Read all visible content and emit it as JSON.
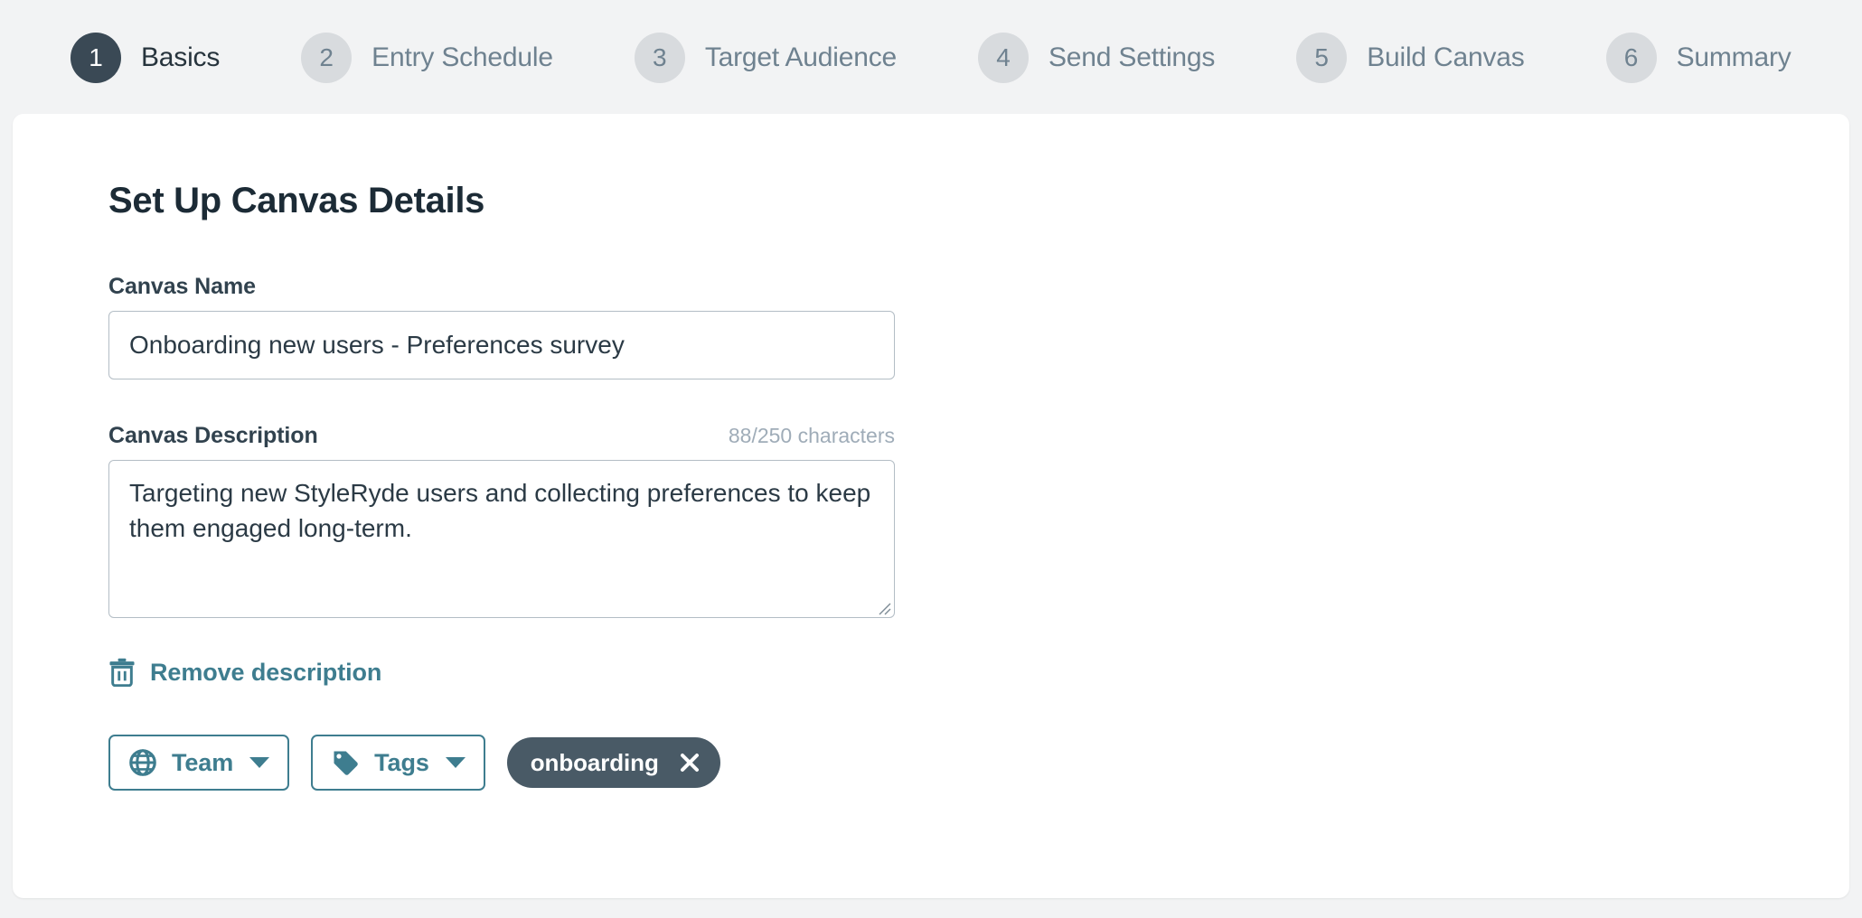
{
  "stepper": {
    "steps": [
      {
        "number": "1",
        "label": "Basics",
        "active": true
      },
      {
        "number": "2",
        "label": "Entry Schedule",
        "active": false
      },
      {
        "number": "3",
        "label": "Target Audience",
        "active": false
      },
      {
        "number": "4",
        "label": "Send Settings",
        "active": false
      },
      {
        "number": "5",
        "label": "Build Canvas",
        "active": false
      },
      {
        "number": "6",
        "label": "Summary",
        "active": false
      }
    ]
  },
  "main": {
    "title": "Set Up Canvas Details",
    "canvas_name": {
      "label": "Canvas Name",
      "value": "Onboarding new users - Preferences survey",
      "placeholder": "Canvas Name"
    },
    "canvas_description": {
      "label": "Canvas Description",
      "counter": "88/250 characters",
      "value": "Targeting new StyleRyde users and collecting preferences to keep them engaged long-term.",
      "placeholder": "Canvas Description"
    },
    "remove_description": {
      "label": "Remove description",
      "icon": "trash-icon"
    },
    "team_button": {
      "label": "Team",
      "icon": "globe-icon"
    },
    "tags_button": {
      "label": "Tags",
      "icon": "tag-icon"
    },
    "tags": [
      {
        "label": "onboarding"
      }
    ]
  },
  "colors": {
    "page_background": "#f2f3f4",
    "card_background": "#ffffff",
    "accent_teal": "#3e7d8f",
    "dark_slate": "#3a4955",
    "chip_background": "#495a66",
    "step_inactive": "#d8dbde",
    "muted_text": "#9facb8",
    "input_border": "#b3bdc5"
  }
}
